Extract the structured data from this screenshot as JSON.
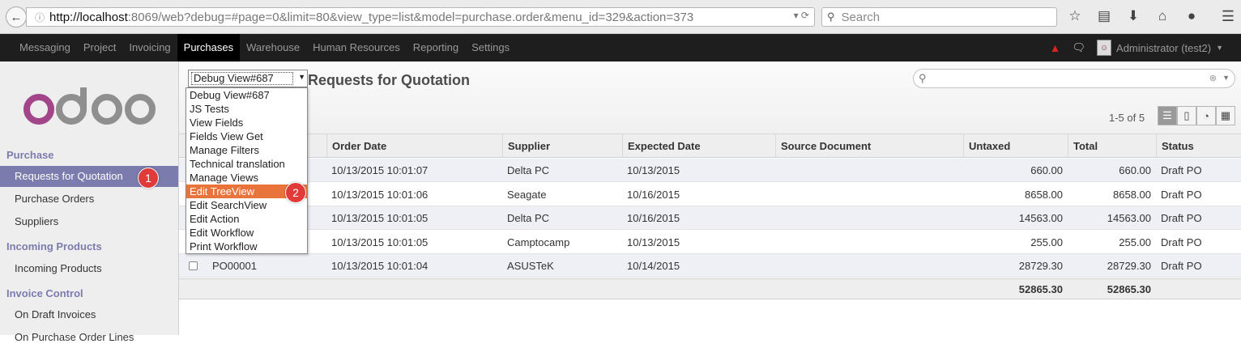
{
  "browser": {
    "url_host": "http://localhost",
    "url_rest": ":8069/web?debug=#page=0&limit=80&view_type=list&model=purchase.order&menu_id=329&action=373",
    "search_placeholder": "Search"
  },
  "topnav": {
    "items": [
      "Messaging",
      "Project",
      "Invoicing",
      "Purchases",
      "Warehouse",
      "Human Resources",
      "Reporting",
      "Settings"
    ],
    "active": "Purchases",
    "user": "Administrator (test2)"
  },
  "sidebar": {
    "sections": [
      {
        "heading": "Purchase",
        "items": [
          "Requests for Quotation",
          "Purchase Orders",
          "Suppliers"
        ]
      },
      {
        "heading": "Incoming Products",
        "items": [
          "Incoming Products"
        ]
      },
      {
        "heading": "Invoice Control",
        "items": [
          "On Draft Invoices",
          "On Purchase Order Lines"
        ]
      }
    ],
    "active_item": "Requests for Quotation",
    "logo_text": "odoo"
  },
  "control_panel": {
    "debug_select_value": "Debug View#687",
    "title": "Requests for Quotation",
    "pager": "1-5 of 5"
  },
  "debug_menu": {
    "options": [
      "Debug View#687",
      "JS Tests",
      "View Fields",
      "Fields View Get",
      "Manage Filters",
      "Technical translation",
      "Manage Views",
      "Edit TreeView",
      "Edit SearchView",
      "Edit Action",
      "Edit Workflow",
      "Print Workflow"
    ],
    "highlighted": "Edit TreeView"
  },
  "annotations": {
    "badge1": "1",
    "badge2": "2"
  },
  "table": {
    "columns": [
      "Order Date",
      "Supplier",
      "Expected Date",
      "Source Document",
      "Untaxed",
      "Total",
      "Status"
    ],
    "rows": [
      {
        "ref": "",
        "order_date": "10/13/2015 10:01:07",
        "supplier": "Delta PC",
        "expected": "10/13/2015",
        "source": "",
        "untaxed": "660.00",
        "total": "660.00",
        "status": "Draft PO"
      },
      {
        "ref": "",
        "order_date": "10/13/2015 10:01:06",
        "supplier": "Seagate",
        "expected": "10/16/2015",
        "source": "",
        "untaxed": "8658.00",
        "total": "8658.00",
        "status": "Draft PO"
      },
      {
        "ref": "",
        "order_date": "10/13/2015 10:01:05",
        "supplier": "Delta PC",
        "expected": "10/16/2015",
        "source": "",
        "untaxed": "14563.00",
        "total": "14563.00",
        "status": "Draft PO"
      },
      {
        "ref": "",
        "order_date": "10/13/2015 10:01:05",
        "supplier": "Camptocamp",
        "expected": "10/13/2015",
        "source": "",
        "untaxed": "255.00",
        "total": "255.00",
        "status": "Draft PO"
      },
      {
        "ref": "PO00001",
        "order_date": "10/13/2015 10:01:04",
        "supplier": "ASUSTeK",
        "expected": "10/14/2015",
        "source": "",
        "untaxed": "28729.30",
        "total": "28729.30",
        "status": "Draft PO"
      }
    ],
    "totals": {
      "untaxed": "52865.30",
      "total": "52865.30"
    }
  },
  "colors": {
    "accent": "#7c7bad",
    "highlight": "#e8743c",
    "badge": "#e03a3a"
  }
}
